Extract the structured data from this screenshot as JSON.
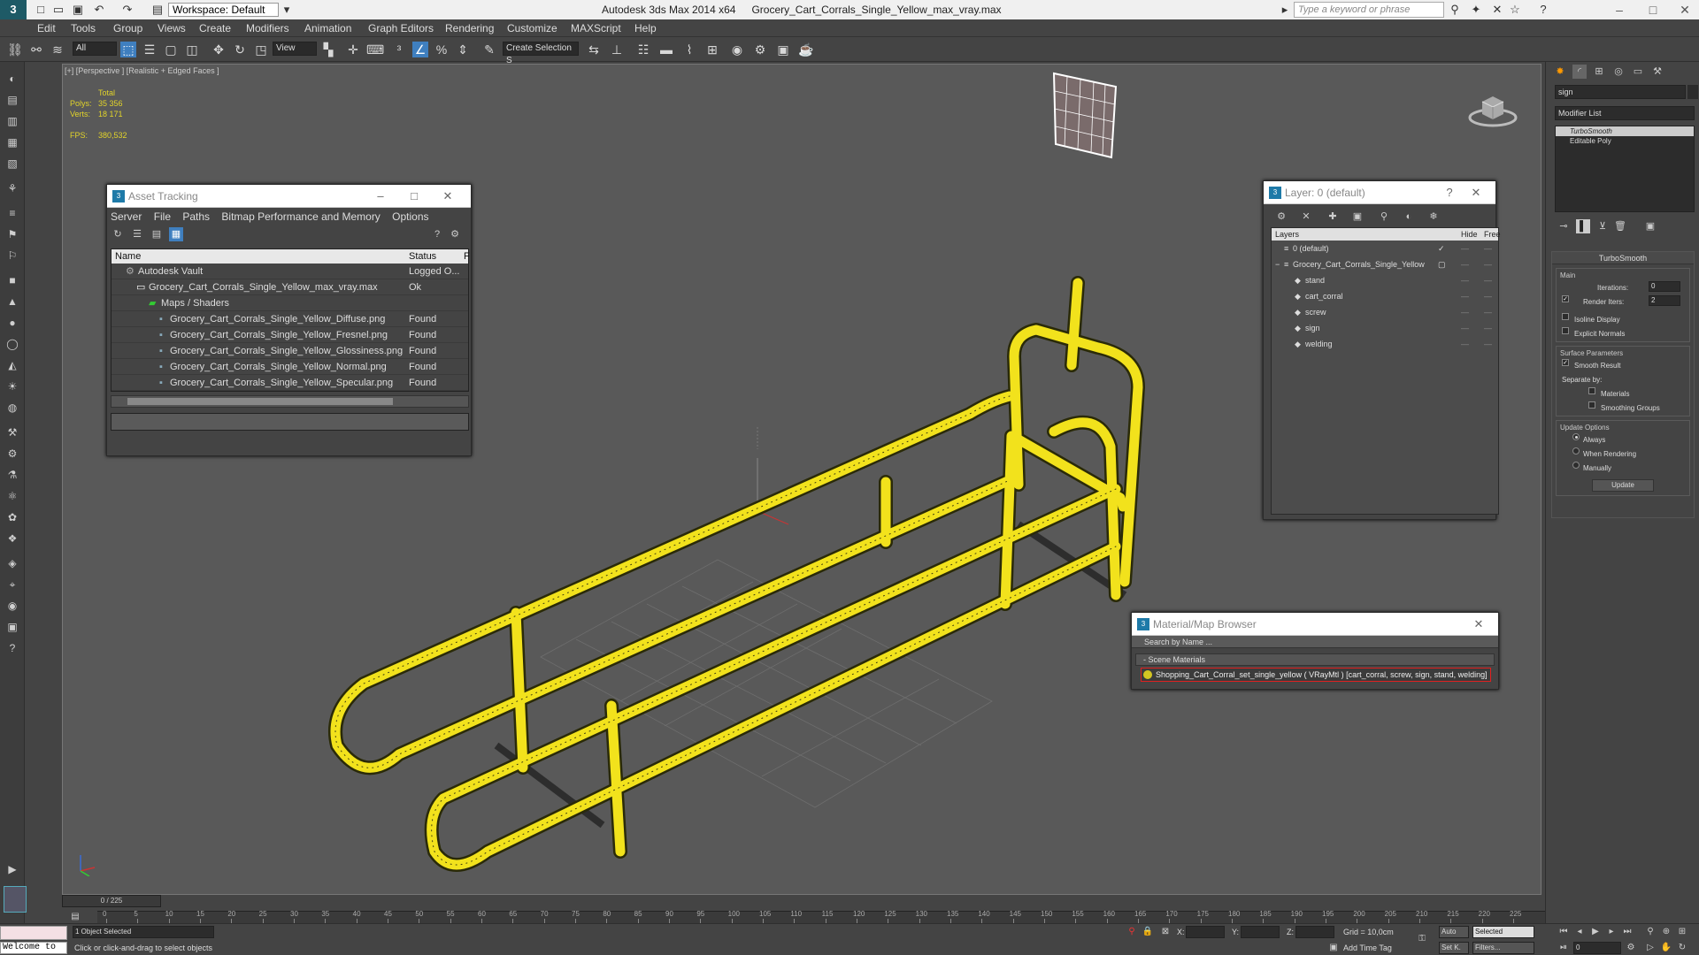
{
  "app": {
    "logo": "3",
    "workspace": "Workspace: Default",
    "product": "Autodesk 3ds Max  2014 x64",
    "file": "Grocery_Cart_Corrals_Single_Yellow_max_vray.max",
    "search_placeholder": "Type a keyword or phrase"
  },
  "menu": [
    "Edit",
    "Tools",
    "Group",
    "Views",
    "Create",
    "Modifiers",
    "Animation",
    "Graph Editors",
    "Rendering",
    "Customize",
    "MAXScript",
    "Help"
  ],
  "toolbar": {
    "selection_filter": "All",
    "ref_coord": "View",
    "named_selection": "Create Selection S"
  },
  "viewport": {
    "label": "[+] [Perspective ] [Realistic + Edged Faces ]",
    "stats_header": "Total",
    "polys_label": "Polys:",
    "polys_value": "35 356",
    "verts_label": "Verts:",
    "verts_value": "18 171",
    "fps_label": "FPS:",
    "fps_value": "380,532",
    "model_color": "#f2e21c"
  },
  "asset_tracking": {
    "title": "Asset Tracking",
    "menu": [
      "Server",
      "File",
      "Paths",
      "Bitmap Performance and Memory",
      "Options"
    ],
    "col_name": "Name",
    "col_status": "Status",
    "col_extra": "F",
    "rows": [
      {
        "name": "Autodesk Vault",
        "status": "Logged O..."
      },
      {
        "name": "Grocery_Cart_Corrals_Single_Yellow_max_vray.max",
        "status": "Ok"
      },
      {
        "name": "Maps / Shaders",
        "status": ""
      },
      {
        "name": "Grocery_Cart_Corrals_Single_Yellow_Diffuse.png",
        "status": "Found"
      },
      {
        "name": "Grocery_Cart_Corrals_Single_Yellow_Fresnel.png",
        "status": "Found"
      },
      {
        "name": "Grocery_Cart_Corrals_Single_Yellow_Glossiness.png",
        "status": "Found"
      },
      {
        "name": "Grocery_Cart_Corrals_Single_Yellow_Normal.png",
        "status": "Found"
      },
      {
        "name": "Grocery_Cart_Corrals_Single_Yellow_Specular.png",
        "status": "Found"
      }
    ]
  },
  "layer_dialog": {
    "title": "Layer: 0 (default)",
    "help": "?",
    "col_layers": "Layers",
    "col_hide": "Hide",
    "col_freeze": "Free",
    "layers": [
      "0 (default)",
      "Grocery_Cart_Corrals_Single_Yellow",
      "stand",
      "cart_corral",
      "screw",
      "sign",
      "welding"
    ]
  },
  "material_browser": {
    "title": "Material/Map Browser",
    "search": "Search by Name ...",
    "section": "- Scene Materials",
    "item": "Shopping_Cart_Corral_set_single_yellow ( VRayMtl ) [cart_corral, screw, sign, stand, welding]",
    "swatch_color": "#d4c522"
  },
  "command_panel": {
    "object_name": "sign",
    "modifier_list": "Modifier List",
    "stack": [
      "TurboSmooth",
      "Editable Poly"
    ],
    "rollout_title": "TurboSmooth",
    "main_label": "Main",
    "iterations_label": "Iterations:",
    "iterations_value": "0",
    "render_iters_label": "Render Iters:",
    "render_iters_value": "2",
    "isoline": "Isoline Display",
    "explicit_normals": "Explicit Normals",
    "surface_params": "Surface Parameters",
    "smooth_result": "Smooth Result",
    "separate_by": "Separate by:",
    "materials": "Materials",
    "smoothing_groups": "Smoothing Groups",
    "update_options": "Update Options",
    "always": "Always",
    "when_rendering": "When Rendering",
    "manually": "Manually",
    "update_btn": "Update"
  },
  "timeline": {
    "frame": "0 / 225",
    "ticks": [
      "0",
      "5",
      "10",
      "15",
      "20",
      "25",
      "30",
      "35",
      "40",
      "45",
      "50",
      "55",
      "60",
      "65",
      "70",
      "75",
      "80",
      "85",
      "90",
      "95",
      "100",
      "105",
      "110",
      "115",
      "120",
      "125",
      "130",
      "135",
      "140",
      "145",
      "150",
      "155",
      "160",
      "165",
      "170",
      "175",
      "180",
      "185",
      "190",
      "195",
      "200",
      "205",
      "210",
      "215",
      "220",
      "225"
    ]
  },
  "status": {
    "maxscript": "Welcome to",
    "selected": "1 Object Selected",
    "prompt": "Click or click-and-drag to select objects",
    "x_label": "X:",
    "y_label": "Y:",
    "z_label": "Z:",
    "grid": "Grid = 10,0cm",
    "add_time_tag": "Add Time Tag",
    "auto": "Auto",
    "selected_drop": "Selected",
    "set_k": "Set K.",
    "filters": "Filters...",
    "frame_field": "0"
  }
}
